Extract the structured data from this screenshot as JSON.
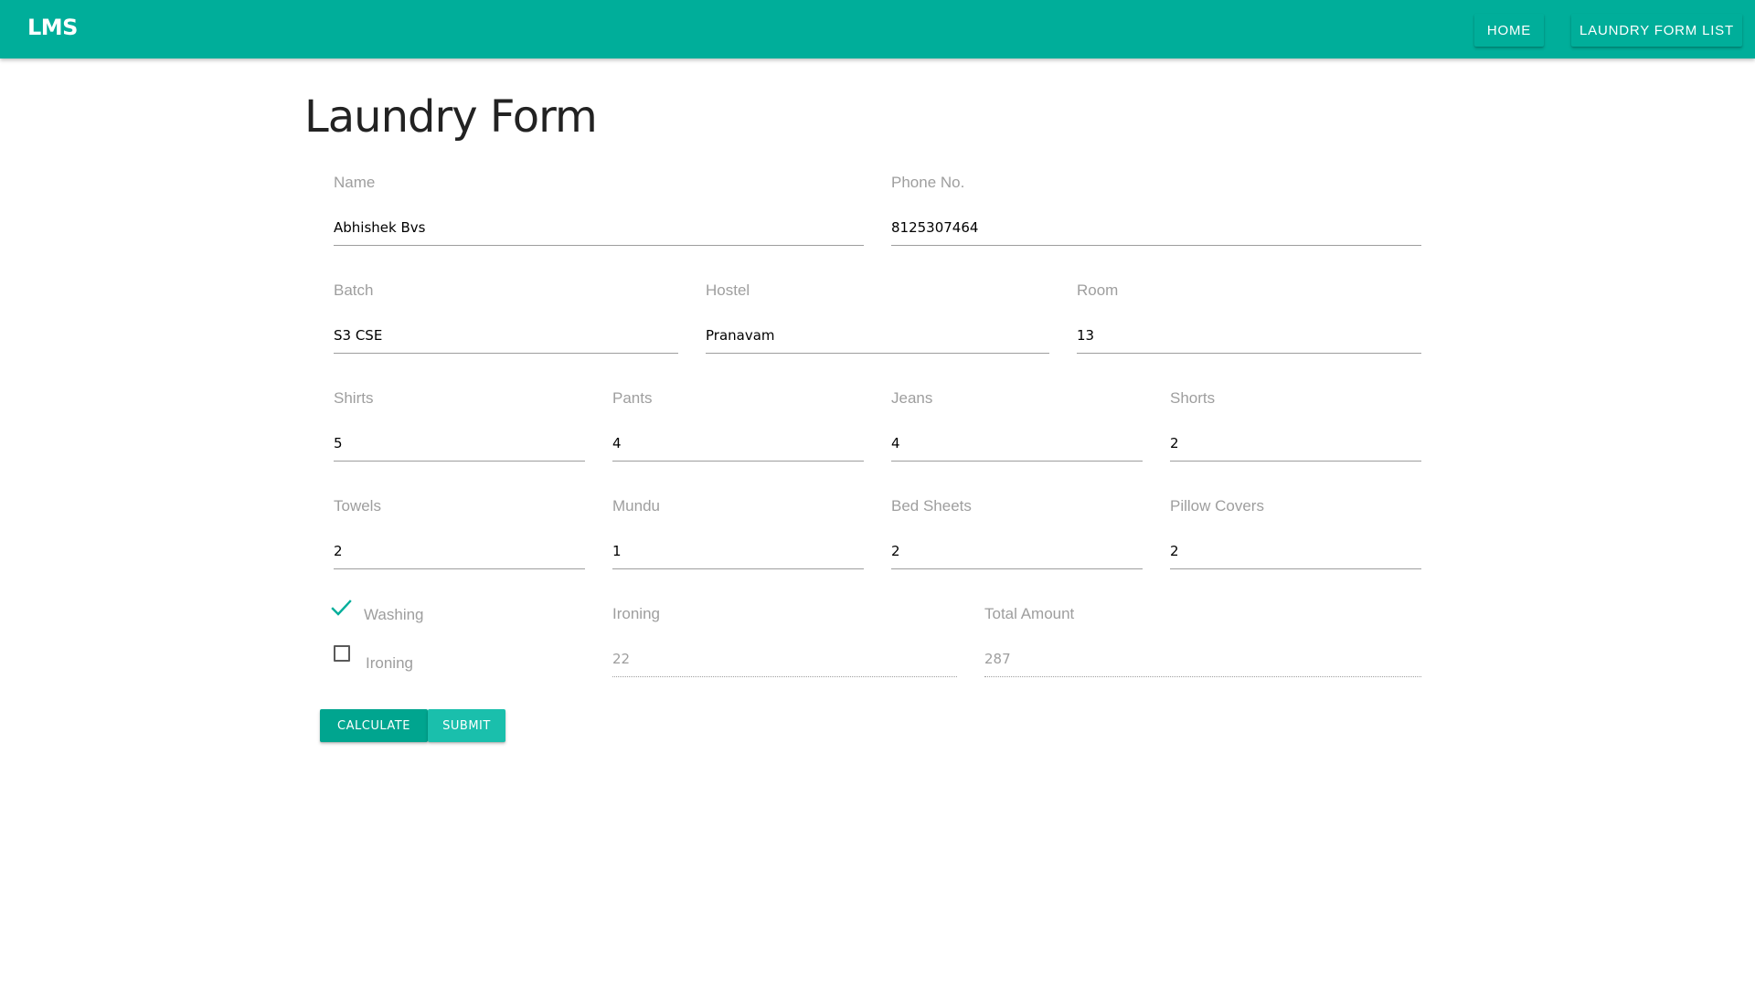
{
  "navbar": {
    "brand": "LMS",
    "home_label": "HOME",
    "list_label": "LAUNDRY FORM LIST",
    "color": "#00ae9a"
  },
  "page": {
    "title": "Laundry Form"
  },
  "form": {
    "name": {
      "label": "Name",
      "value": "Abhishek Bvs"
    },
    "phone": {
      "label": "Phone No.",
      "value": "8125307464"
    },
    "batch": {
      "label": "Batch",
      "value": "S3 CSE"
    },
    "hostel": {
      "label": "Hostel",
      "value": "Pranavam"
    },
    "room": {
      "label": "Room",
      "value": "13"
    },
    "shirts": {
      "label": "Shirts",
      "value": "5"
    },
    "pants": {
      "label": "Pants",
      "value": "4"
    },
    "jeans": {
      "label": "Jeans",
      "value": "4"
    },
    "shorts": {
      "label": "Shorts",
      "value": "2"
    },
    "towels": {
      "label": "Towels",
      "value": "2"
    },
    "mundu": {
      "label": "Mundu",
      "value": "1"
    },
    "bed_sheets": {
      "label": "Bed Sheets",
      "value": "2"
    },
    "pillow_covers": {
      "label": "Pillow Covers",
      "value": "2"
    },
    "washing_checkbox": {
      "label": "Washing",
      "checked": true
    },
    "ironing_checkbox": {
      "label": "Ironing",
      "checked": false
    },
    "ironing_count": {
      "label": "Ironing",
      "value": "22"
    },
    "total_amount": {
      "label": "Total Amount",
      "value": "287"
    }
  },
  "actions": {
    "calculate_label": "CALCULATE",
    "submit_label": "SUBMIT"
  },
  "icons": {
    "washing_check": "checkmark-icon",
    "ironing_check": "checkbox-empty-icon"
  }
}
